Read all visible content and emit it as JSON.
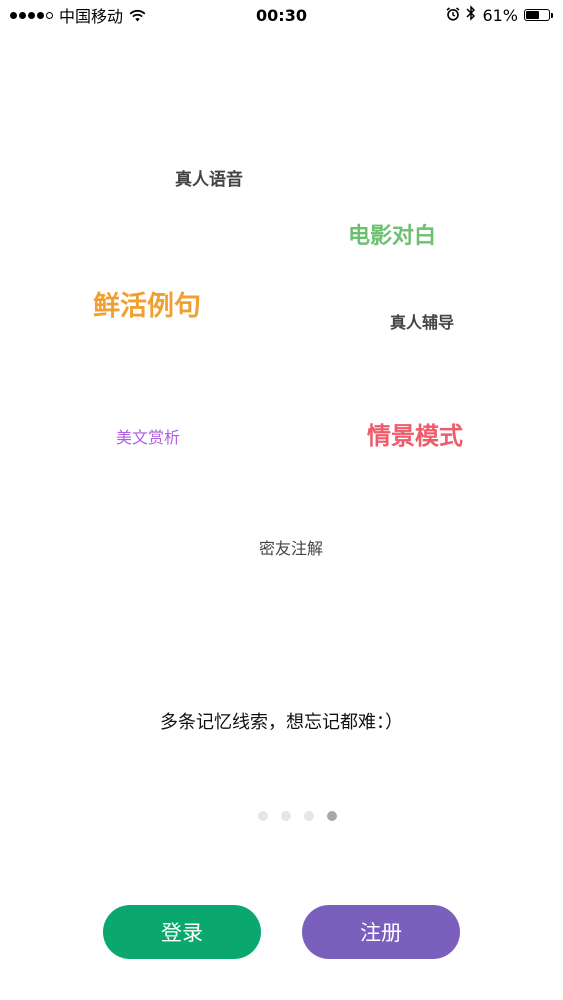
{
  "status_bar": {
    "carrier": "中国移动",
    "time": "00:30",
    "battery_percent": "61%",
    "battery_level": 0.61,
    "icons": [
      "signal-icon",
      "wifi-icon",
      "alarm-icon",
      "bluetooth-icon",
      "battery-icon"
    ]
  },
  "features": {
    "voice": "真人语音",
    "movie": "电影对白",
    "example": "鲜活例句",
    "tutor": "真人辅导",
    "prose": "美文赏析",
    "scene": "情景模式",
    "notes": "密友注解"
  },
  "colors": {
    "movie": "#6cc070",
    "example": "#f0a030",
    "prose": "#b05ee6",
    "scene": "#ee5c6c",
    "login_button": "#0aa86e",
    "register_button": "#7b5fbd"
  },
  "tagline": "多条记忆线索，想忘记都难：）",
  "pager": {
    "total": 4,
    "active_index": 4
  },
  "buttons": {
    "login": "登录",
    "register": "注册"
  }
}
